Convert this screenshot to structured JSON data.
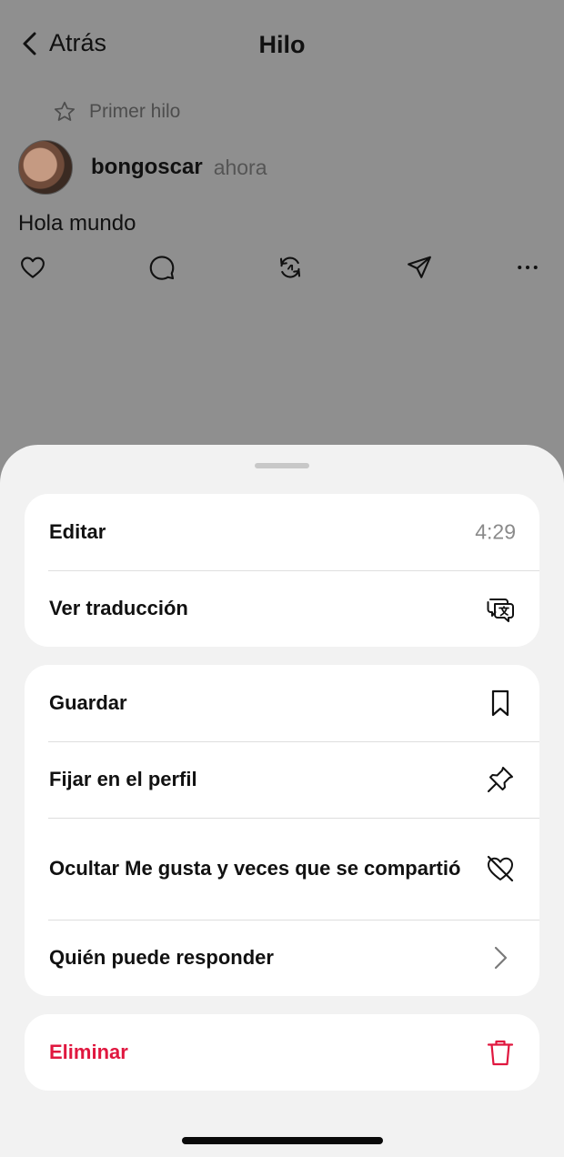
{
  "navbar": {
    "back_label": "Atrás",
    "title": "Hilo"
  },
  "post": {
    "badge": "Primer hilo",
    "username": "bongoscar",
    "time": "ahora",
    "text": "Hola mundo",
    "actions": [
      "heart-icon",
      "comment-icon",
      "repost-icon",
      "share-icon",
      "more-icon"
    ]
  },
  "sheet": {
    "group1": [
      {
        "label": "Editar",
        "value": "4:29"
      },
      {
        "label": "Ver traducción",
        "icon": "translate-icon"
      }
    ],
    "group2": [
      {
        "label": "Guardar",
        "icon": "bookmark-icon"
      },
      {
        "label": "Fijar en el perfil",
        "icon": "pin-icon"
      },
      {
        "label": "Ocultar Me gusta y veces que se compartió",
        "icon": "heart-off-icon"
      },
      {
        "label": "Quién puede responder",
        "icon": "chevron-right-icon"
      }
    ],
    "group3": [
      {
        "label": "Eliminar",
        "icon": "trash-icon"
      }
    ]
  },
  "colors": {
    "dim_background": "#8f8f8f",
    "sheet_background": "#f2f2f2",
    "danger": "#e0173f"
  }
}
